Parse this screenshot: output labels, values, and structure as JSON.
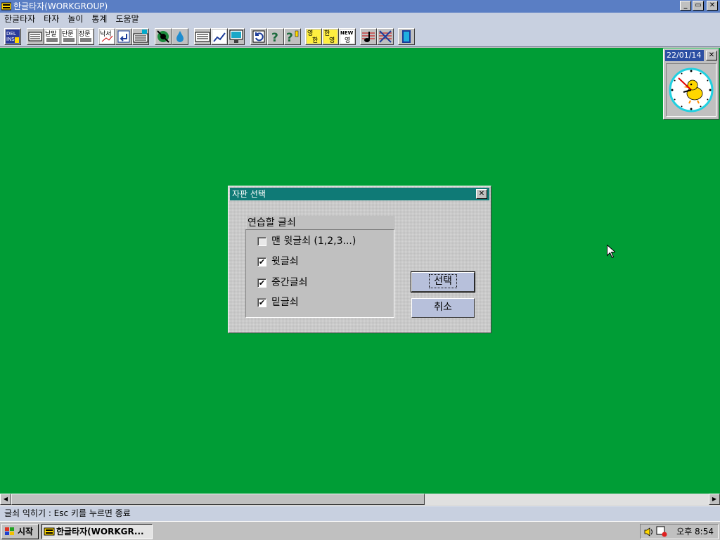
{
  "window": {
    "title": "한글타자(WORKGROUP)",
    "min": "_",
    "max": "▭",
    "close": "✕"
  },
  "menu": [
    "한글타자",
    "타자",
    "놀이",
    "통계",
    "도움말"
  ],
  "toolbar": {
    "buttons": [
      "del-ins-icon",
      "keyboard-icon",
      "word-practice-icon",
      "short-text-icon",
      "long-text-icon",
      "doodle-icon",
      "return-icon",
      "keyboard-typing-icon",
      "eye-icon",
      "water-drop-icon",
      "keyboard-layout-icon",
      "record-graph-icon",
      "monitor-icon",
      "refresh-icon",
      "help-icon",
      "help-context-icon",
      "korean-english-icon",
      "hanja-icon",
      "new-english-icon",
      "sound-icon",
      "mute-icon",
      "exit-door-icon"
    ],
    "text": {
      "del": "DEL",
      "ins": "INS",
      "natmal": "낱말",
      "danmun": "단문",
      "jangmun": "장문",
      "naksu": "낙서",
      "yeong": "영",
      "han": "한",
      "hanja": "한",
      "new": "NEW"
    }
  },
  "clock": {
    "date": "22/01/14",
    "close": "✕"
  },
  "dialog": {
    "title": "자판 선택",
    "close": "✕",
    "group_label": "연습할 글쇠",
    "options": [
      {
        "label": "맨 윗글쇠 (1,2,3...)",
        "checked": false,
        "mark": ""
      },
      {
        "label": "윗글쇠",
        "checked": true,
        "mark": "✔"
      },
      {
        "label": "중간글쇠",
        "checked": true,
        "mark": "✔"
      },
      {
        "label": "밑글쇠",
        "checked": true,
        "mark": "✔"
      }
    ],
    "ok": "선택",
    "cancel": "취소"
  },
  "scrollbar": {
    "left": "◀",
    "right": "▶"
  },
  "status": "글쇠 익히기 : Esc 키를 누르면 종료",
  "taskbar": {
    "start": "시작",
    "task": "한글타자(WORKGR...",
    "time": "오후 8:54"
  },
  "colors": {
    "workspace": "#009d36",
    "titlebar": "#5a7ec4",
    "dialog_title": "#0f7a76"
  }
}
